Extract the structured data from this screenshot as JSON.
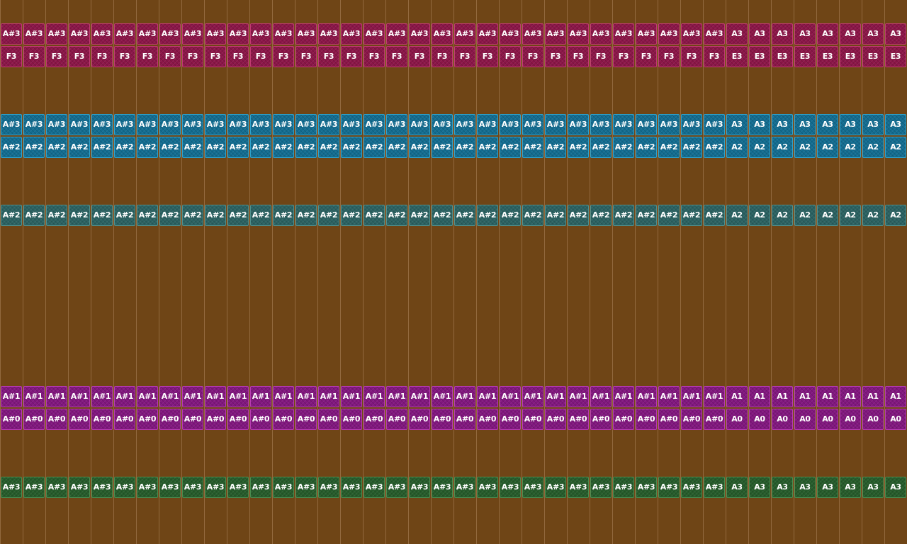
{
  "editor": {
    "background_color": "#6f4516"
  },
  "tracks": [
    {
      "name": "crimson",
      "fill": "#8c1648",
      "edge": "#c03a72",
      "rows": [
        {
          "pitches": [
            "A#3",
            "A#3",
            "A#3",
            "A#3",
            "A#3",
            "A#3",
            "A#3",
            "A#3",
            "A#3",
            "A#3",
            "A#3",
            "A#3",
            "A#3",
            "A#3",
            "A#3",
            "A#3",
            "A#3",
            "A#3",
            "A#3",
            "A#3",
            "A#3",
            "A#3",
            "A#3",
            "A#3",
            "A#3",
            "A#3",
            "A#3",
            "A#3",
            "A#3",
            "A#3",
            "A#3",
            "A#3",
            "A3",
            "A3",
            "A3",
            "A3",
            "A3",
            "A3",
            "A3",
            "A3"
          ]
        },
        {
          "pitches": [
            "F3",
            "F3",
            "F3",
            "F3",
            "F3",
            "F3",
            "F3",
            "F3",
            "F3",
            "F3",
            "F3",
            "F3",
            "F3",
            "F3",
            "F3",
            "F3",
            "F3",
            "F3",
            "F3",
            "F3",
            "F3",
            "F3",
            "F3",
            "F3",
            "F3",
            "F3",
            "F3",
            "F3",
            "F3",
            "F3",
            "F3",
            "F3",
            "E3",
            "E3",
            "E3",
            "E3",
            "E3",
            "E3",
            "E3",
            "E3"
          ]
        }
      ]
    },
    {
      "name": "blue",
      "fill": "#136d91",
      "edge": "#2ea2cc",
      "rows": [
        {
          "pitches": [
            "A#3",
            "A#3",
            "A#3",
            "A#3",
            "A#3",
            "A#3",
            "A#3",
            "A#3",
            "A#3",
            "A#3",
            "A#3",
            "A#3",
            "A#3",
            "A#3",
            "A#3",
            "A#3",
            "A#3",
            "A#3",
            "A#3",
            "A#3",
            "A#3",
            "A#3",
            "A#3",
            "A#3",
            "A#3",
            "A#3",
            "A#3",
            "A#3",
            "A#3",
            "A#3",
            "A#3",
            "A#3",
            "A3",
            "A3",
            "A3",
            "A3",
            "A3",
            "A3",
            "A3",
            "A3"
          ]
        },
        {
          "pitches": [
            "A#2",
            "A#2",
            "A#2",
            "A#2",
            "A#2",
            "A#2",
            "A#2",
            "A#2",
            "A#2",
            "A#2",
            "A#2",
            "A#2",
            "A#2",
            "A#2",
            "A#2",
            "A#2",
            "A#2",
            "A#2",
            "A#2",
            "A#2",
            "A#2",
            "A#2",
            "A#2",
            "A#2",
            "A#2",
            "A#2",
            "A#2",
            "A#2",
            "A#2",
            "A#2",
            "A#2",
            "A#2",
            "A2",
            "A2",
            "A2",
            "A2",
            "A2",
            "A2",
            "A2",
            "A2"
          ]
        }
      ]
    },
    {
      "name": "teal",
      "fill": "#2b6262",
      "edge": "#4f8f8c",
      "rows": [
        {
          "pitches": [
            "A#2",
            "A#2",
            "A#2",
            "A#2",
            "A#2",
            "A#2",
            "A#2",
            "A#2",
            "A#2",
            "A#2",
            "A#2",
            "A#2",
            "A#2",
            "A#2",
            "A#2",
            "A#2",
            "A#2",
            "A#2",
            "A#2",
            "A#2",
            "A#2",
            "A#2",
            "A#2",
            "A#2",
            "A#2",
            "A#2",
            "A#2",
            "A#2",
            "A#2",
            "A#2",
            "A#2",
            "A#2",
            "A2",
            "A2",
            "A2",
            "A2",
            "A2",
            "A2",
            "A2",
            "A2"
          ]
        }
      ]
    },
    {
      "name": "purple",
      "fill": "#82177f",
      "edge": "#b73cb2",
      "rows": [
        {
          "pitches": [
            "A#1",
            "A#1",
            "A#1",
            "A#1",
            "A#1",
            "A#1",
            "A#1",
            "A#1",
            "A#1",
            "A#1",
            "A#1",
            "A#1",
            "A#1",
            "A#1",
            "A#1",
            "A#1",
            "A#1",
            "A#1",
            "A#1",
            "A#1",
            "A#1",
            "A#1",
            "A#1",
            "A#1",
            "A#1",
            "A#1",
            "A#1",
            "A#1",
            "A#1",
            "A#1",
            "A#1",
            "A#1",
            "A1",
            "A1",
            "A1",
            "A1",
            "A1",
            "A1",
            "A1",
            "A1"
          ]
        },
        {
          "pitches": [
            "A#0",
            "A#0",
            "A#0",
            "A#0",
            "A#0",
            "A#0",
            "A#0",
            "A#0",
            "A#0",
            "A#0",
            "A#0",
            "A#0",
            "A#0",
            "A#0",
            "A#0",
            "A#0",
            "A#0",
            "A#0",
            "A#0",
            "A#0",
            "A#0",
            "A#0",
            "A#0",
            "A#0",
            "A#0",
            "A#0",
            "A#0",
            "A#0",
            "A#0",
            "A#0",
            "A#0",
            "A#0",
            "A0",
            "A0",
            "A0",
            "A0",
            "A0",
            "A0",
            "A0",
            "A0"
          ]
        }
      ]
    },
    {
      "name": "green",
      "fill": "#265c2b",
      "edge": "#4a8c4f",
      "rows": [
        {
          "pitches": [
            "A#3",
            "A#3",
            "A#3",
            "A#3",
            "A#3",
            "A#3",
            "A#3",
            "A#3",
            "A#3",
            "A#3",
            "A#3",
            "A#3",
            "A#3",
            "A#3",
            "A#3",
            "A#3",
            "A#3",
            "A#3",
            "A#3",
            "A#3",
            "A#3",
            "A#3",
            "A#3",
            "A#3",
            "A#3",
            "A#3",
            "A#3",
            "A#3",
            "A#3",
            "A#3",
            "A#3",
            "A#3",
            "A3",
            "A3",
            "A3",
            "A3",
            "A3",
            "A3",
            "A3",
            "A3"
          ]
        }
      ]
    }
  ]
}
